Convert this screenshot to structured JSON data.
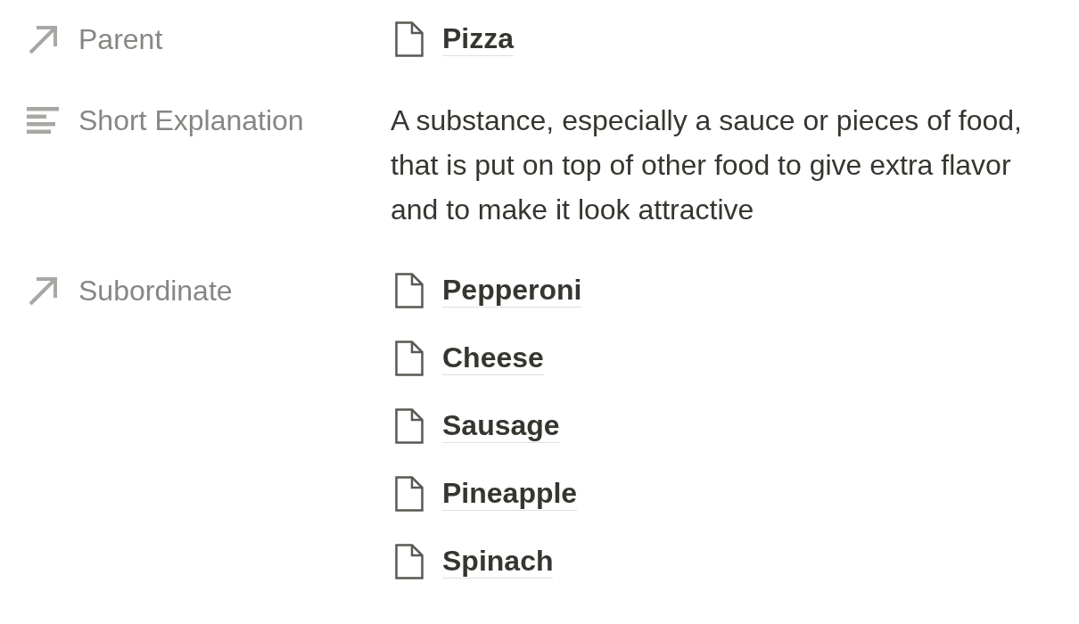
{
  "properties": [
    {
      "kind": "relation",
      "name": "Parent",
      "pages": [
        "Pizza"
      ]
    },
    {
      "kind": "text",
      "name": "Short Explanation",
      "text": "A substance, especially a sauce or pieces of food, that is put on top of other food to give extra flavor and to make it look attractive"
    },
    {
      "kind": "relation",
      "name": "Subordinate",
      "pages": [
        "Pepperoni",
        "Cheese",
        "Sausage",
        "Pineapple",
        "Spinach"
      ]
    }
  ]
}
